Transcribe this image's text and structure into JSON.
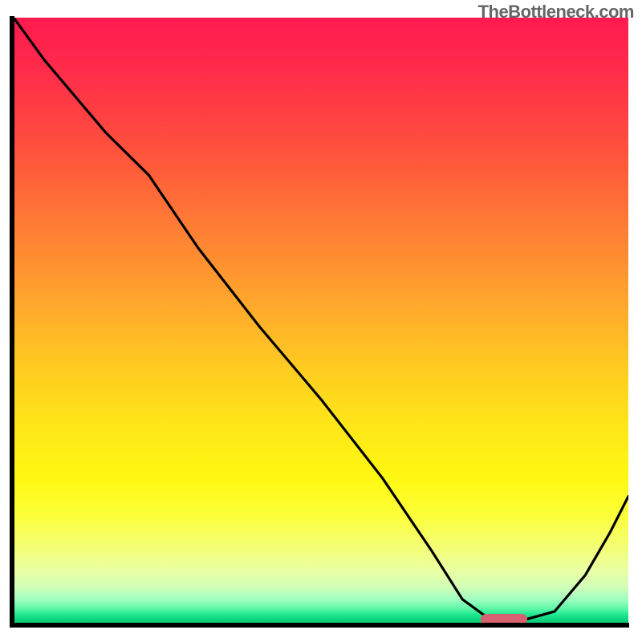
{
  "attribution": "TheBottleneck.com",
  "chart_data": {
    "type": "line",
    "title": "",
    "xlabel": "",
    "ylabel": "",
    "xlim": [
      0,
      100
    ],
    "ylim": [
      0,
      100
    ],
    "series": [
      {
        "name": "bottleneck-curve",
        "x": [
          0,
          5,
          15,
          22,
          30,
          40,
          50,
          60,
          68,
          73,
          78,
          82,
          88,
          93,
          97,
          100
        ],
        "values": [
          100,
          93,
          81,
          74,
          62,
          49,
          37,
          24,
          12,
          4,
          0.3,
          0.3,
          2,
          8,
          15,
          21
        ]
      }
    ],
    "marker": {
      "x_start": 76,
      "x_end": 83.5,
      "y": 0.6,
      "color": "#d86070"
    },
    "gradient_stops": [
      {
        "pos": 0,
        "color": "#ff1a50"
      },
      {
        "pos": 0.38,
        "color": "#ff8832"
      },
      {
        "pos": 0.68,
        "color": "#ffe818"
      },
      {
        "pos": 0.87,
        "color": "#f4ff70"
      },
      {
        "pos": 0.97,
        "color": "#a0ffc0"
      },
      {
        "pos": 1.0,
        "color": "#06c870"
      }
    ],
    "axes": {
      "show_ticks": false,
      "show_grid": false
    }
  }
}
